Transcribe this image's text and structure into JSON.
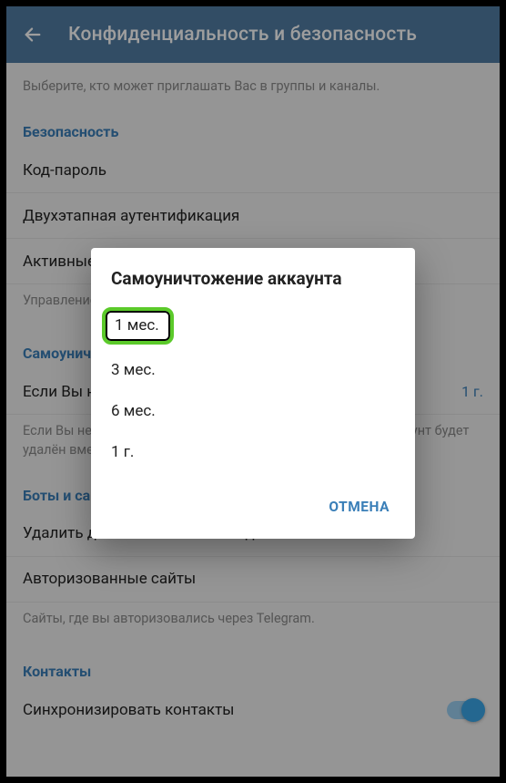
{
  "header": {
    "title": "Конфиденциальность и безопасность"
  },
  "groups_hint": "Выберите, кто может приглашать Вас в группы и каналы.",
  "security": {
    "header": "Безопасность",
    "passcode": "Код-пароль",
    "two_step": "Двухэтапная аутентификация",
    "active_sessions": "Активные сеансы",
    "active_hint": "Управление сеансами на других устройствах."
  },
  "self_destruct": {
    "header_partial": "Самоуничтожение",
    "row_label_partial": "Если Вы не заходили",
    "row_value": "1 г.",
    "hint_partial": "Если Вы не заходите в Telegram в течение этого времени, аккаунт будет удалён вместе со всеми сообщениями, контактами и медиа."
  },
  "bots": {
    "header_partial": "Боты и сайты",
    "clear_payments": "Удалить данные о платежах и доставке",
    "authorized_sites": "Авторизованные сайты",
    "hint": "Сайты, где вы авторизовались через Telegram."
  },
  "contacts": {
    "header": "Контакты",
    "sync": "Синхронизировать контакты"
  },
  "dialog": {
    "title": "Самоуничтожение аккаунта",
    "options": [
      "1 мес.",
      "3 мес.",
      "6 мес.",
      "1 г."
    ],
    "selected_index": 0,
    "cancel": "ОТМЕНА"
  },
  "colors": {
    "header_bg": "#527da3",
    "accent": "#3a7fb8",
    "highlight_border": "#5bca2a"
  }
}
